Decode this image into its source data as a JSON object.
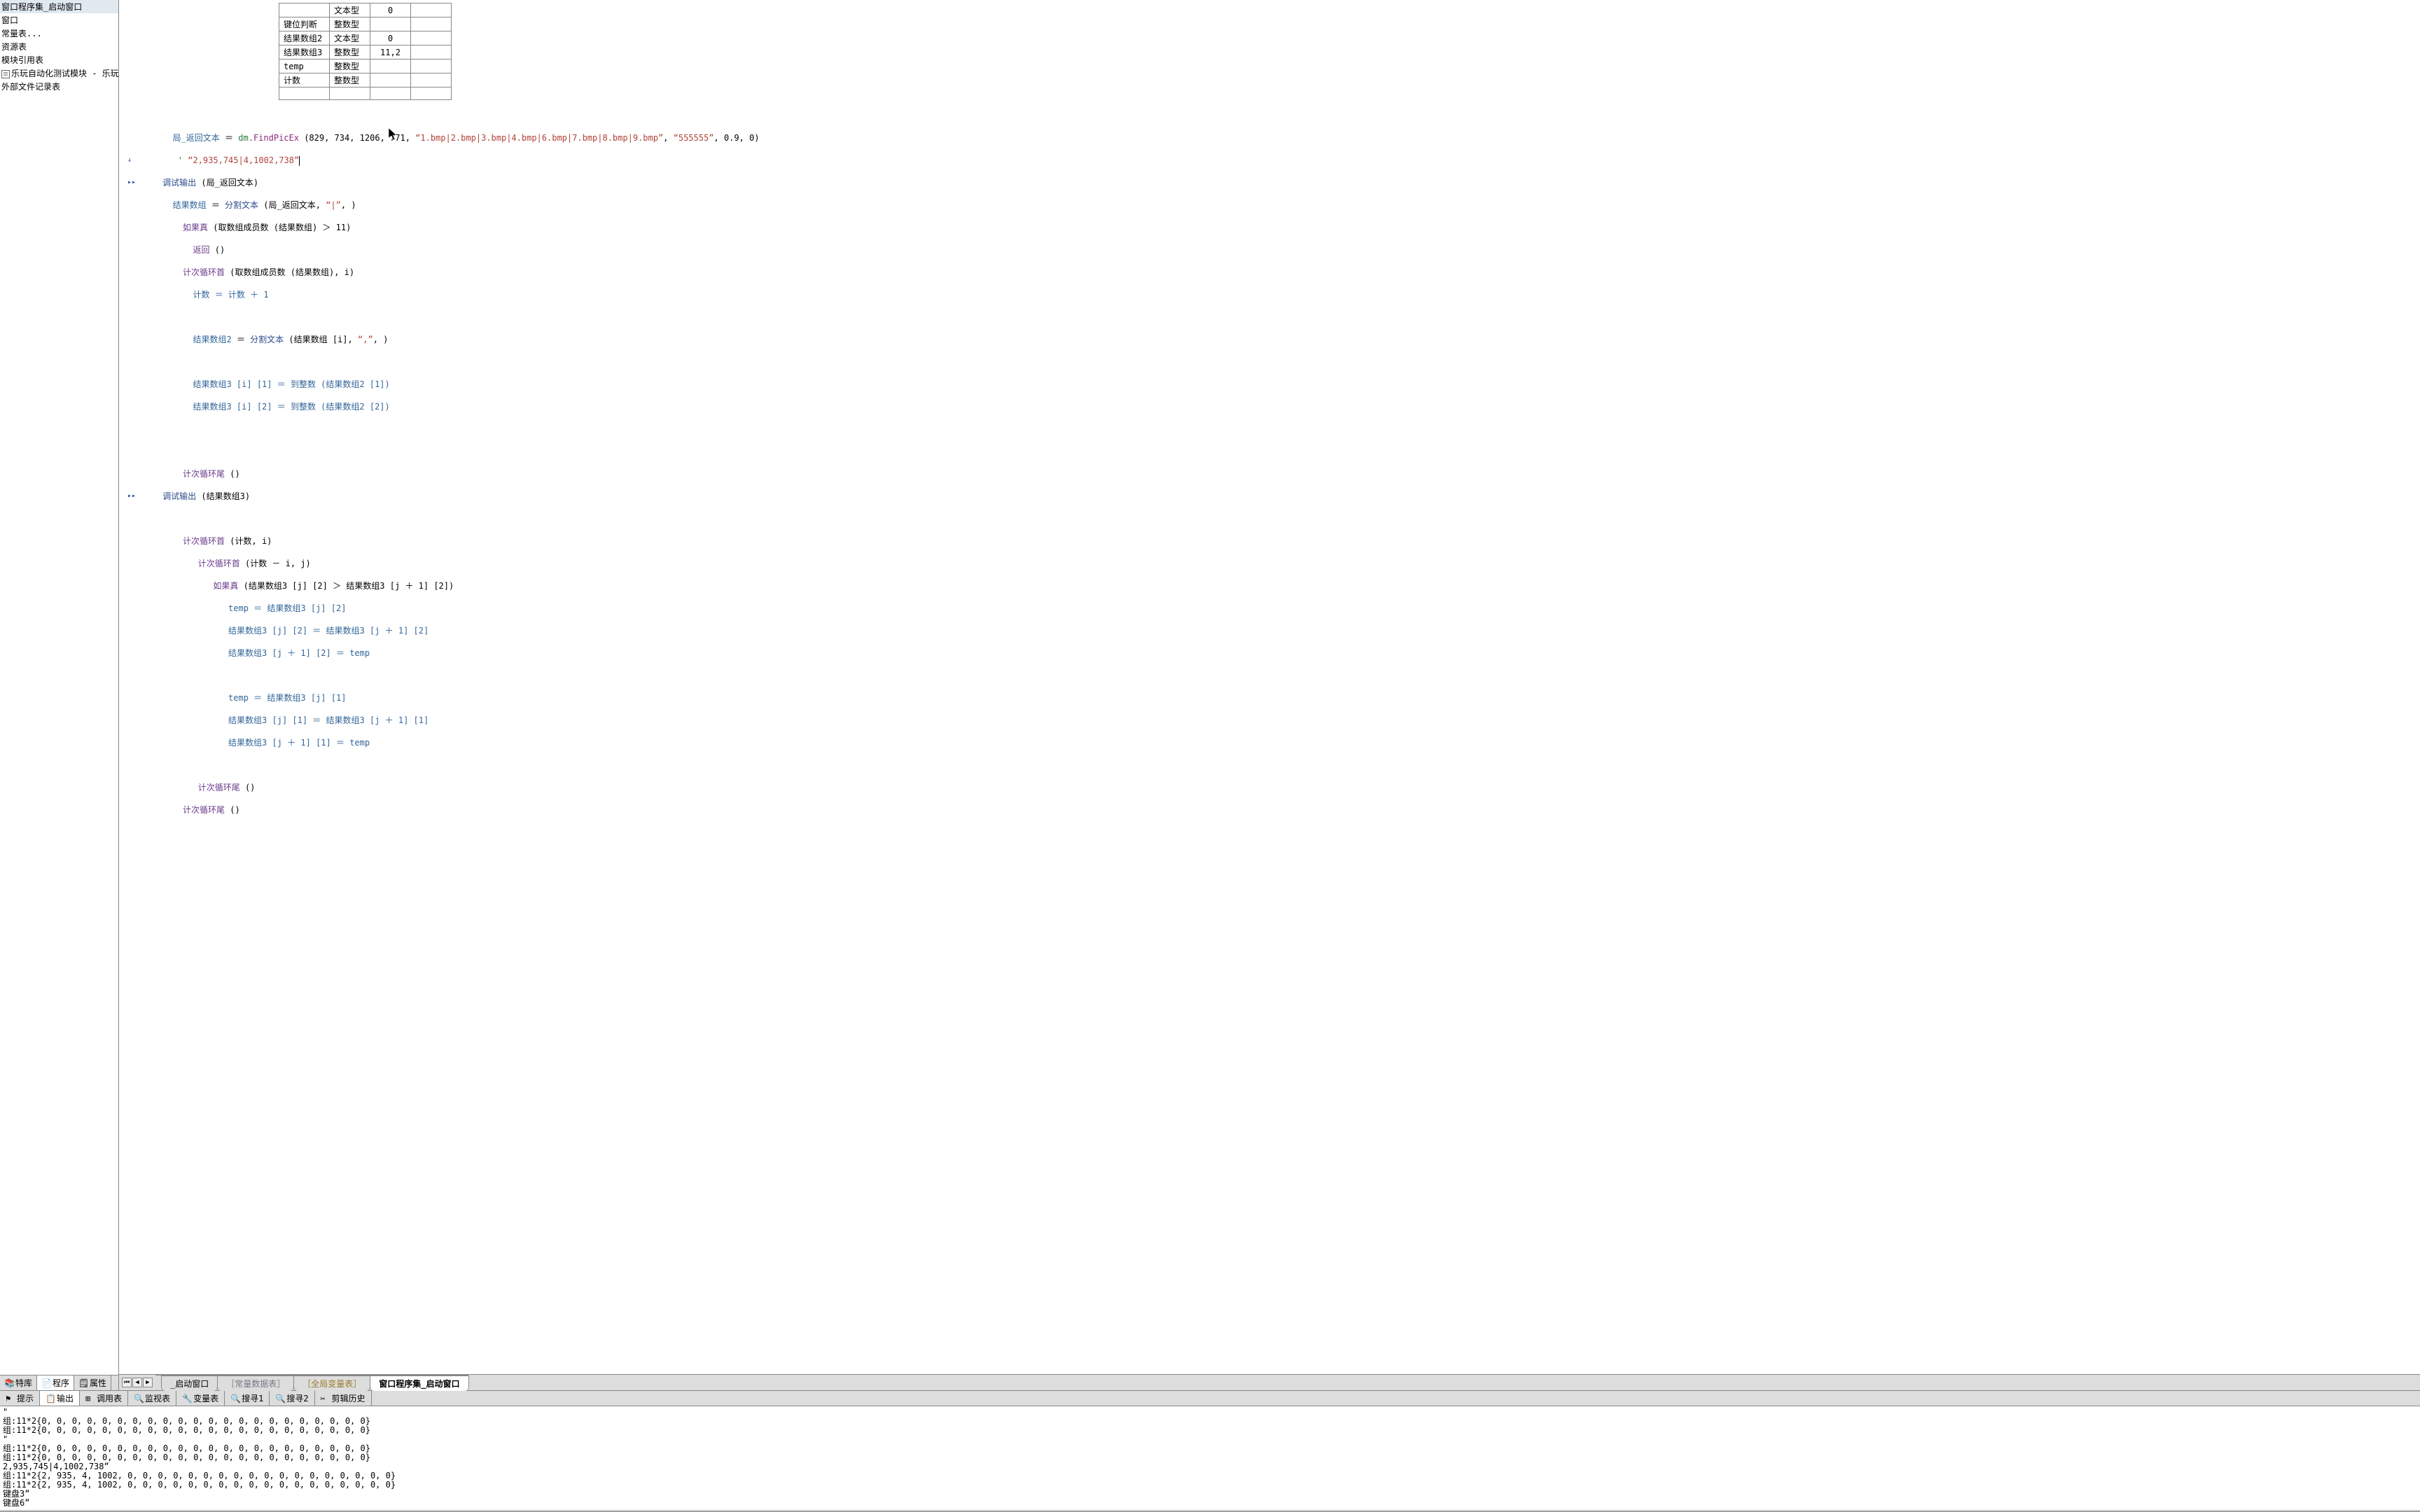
{
  "sidebar": {
    "items": [
      {
        "label": "窗口程序集_启动窗口"
      },
      {
        "label": "窗口"
      },
      {
        "label": "常量表..."
      },
      {
        "label": "资源表"
      },
      {
        "label": "模块引用表"
      },
      {
        "label": "乐玩自动化测试模块 - 乐玩模",
        "icon": true
      },
      {
        "label": "外部文件记录表"
      }
    ],
    "tabs": [
      {
        "label": "特库"
      },
      {
        "label": "程序"
      },
      {
        "label": "属性"
      }
    ]
  },
  "var_table": {
    "rows": [
      {
        "name": "",
        "type": "文本型",
        "val": "0",
        "extra": ""
      },
      {
        "name": "键位判断",
        "type": "整数型",
        "val": "",
        "extra": ""
      },
      {
        "name": "结果数组2",
        "type": "文本型",
        "val": "0",
        "extra": ""
      },
      {
        "name": "结果数组3",
        "type": "整数型",
        "val": "11,2",
        "extra": ""
      },
      {
        "name": "temp",
        "type": "整数型",
        "val": "",
        "extra": ""
      },
      {
        "name": "计数",
        "type": "整数型",
        "val": "",
        "extra": ""
      }
    ]
  },
  "code": {
    "l1_var": "局_返回文本",
    "l1_eq": " ＝ ",
    "l1_obj": "dm.",
    "l1_method": "FindPicEx",
    "l1_args": " (829, 734, 1206, 771, ",
    "l1_str1": "“1.bmp|2.bmp|3.bmp|4.bmp|6.bmp|7.bmp|8.bmp|9.bmp”",
    "l1_mid": ", ",
    "l1_str2": "“555555”",
    "l1_tail": ", 0.9, 0)",
    "l2_comment": "' ",
    "l2_str": "“2,935,745|4,1002,738”",
    "l3_fn": "调试输出",
    "l3_arg": " (局_返回文本)",
    "l4_var": "结果数组",
    "l4_fn": "分割文本",
    "l4_args_a": " (局_返回文本, ",
    "l4_str": "“|”",
    "l4_args_b": ", )",
    "l5_kw": "如果真",
    "l5_args": " (取数组成员数 (结果数组) ＞ 11)",
    "l6_kw": "返回",
    "l6_args": " ()",
    "l7_kw": "计次循环首",
    "l7_args": " (取数组成员数 (结果数组), i)",
    "l8": "计数 ＝ 计数 ＋ 1",
    "l9_var": "结果数组2",
    "l9_fn": "分割文本",
    "l9_args_a": " (结果数组 [i], ",
    "l9_str": "“,”",
    "l9_args_b": ", )",
    "l10": "结果数组3 [i] [1] ＝ 到整数 (结果数组2 [1])",
    "l11": "结果数组3 [i] [2] ＝ 到整数 (结果数组2 [2])",
    "l12_kw": "计次循环尾",
    "l12_args": " ()",
    "l13_fn": "调试输出",
    "l13_arg": " (结果数组3)",
    "l14_kw": "计次循环首",
    "l14_args": " (计数, i)",
    "l15_kw": "计次循环首",
    "l15_args": " (计数 － i, j)",
    "l16_kw": "如果真",
    "l16_args": " (结果数组3 [j] [2] ＞ 结果数组3 [j ＋ 1] [2])",
    "l17": "temp ＝ 结果数组3 [j] [2]",
    "l18": "结果数组3 [j] [2] ＝ 结果数组3 [j ＋ 1] [2]",
    "l19": "结果数组3 [j ＋ 1] [2] ＝ temp",
    "l20": "temp ＝ 结果数组3 [j] [1]",
    "l21": "结果数组3 [j] [1] ＝ 结果数组3 [j ＋ 1] [1]",
    "l22": "结果数组3 [j ＋ 1] [1] ＝ temp",
    "l23_kw": "计次循环尾",
    "l23_args": " ()",
    "l24_kw": "计次循环尾",
    "l24_args": " ()"
  },
  "editor_tabs": [
    {
      "label": "_启动窗口"
    },
    {
      "label": "［常量数据表］",
      "dim": true
    },
    {
      "label": "［全局变量表］",
      "dim": true,
      "gold": true
    },
    {
      "label": "窗口程序集_启动窗口",
      "active": true
    }
  ],
  "bottom_tabs": [
    {
      "label": "提示"
    },
    {
      "label": "输出",
      "active": true
    },
    {
      "label": "调用表"
    },
    {
      "label": "监视表"
    },
    {
      "label": "变量表"
    },
    {
      "label": "搜寻1"
    },
    {
      "label": "搜寻2"
    },
    {
      "label": "剪辑历史"
    }
  ],
  "output": [
    "\"",
    "组:11*2{0, 0, 0, 0, 0, 0, 0, 0, 0, 0, 0, 0, 0, 0, 0, 0, 0, 0, 0, 0, 0, 0}",
    "组:11*2{0, 0, 0, 0, 0, 0, 0, 0, 0, 0, 0, 0, 0, 0, 0, 0, 0, 0, 0, 0, 0, 0}",
    "\"",
    "组:11*2{0, 0, 0, 0, 0, 0, 0, 0, 0, 0, 0, 0, 0, 0, 0, 0, 0, 0, 0, 0, 0, 0}",
    "组:11*2{0, 0, 0, 0, 0, 0, 0, 0, 0, 0, 0, 0, 0, 0, 0, 0, 0, 0, 0, 0, 0, 0}",
    "2,935,745|4,1002,738”",
    "组:11*2{2, 935, 4, 1002, 0, 0, 0, 0, 0, 0, 0, 0, 0, 0, 0, 0, 0, 0, 0, 0, 0, 0}",
    "组:11*2{2, 935, 4, 1002, 0, 0, 0, 0, 0, 0, 0, 0, 0, 0, 0, 0, 0, 0, 0, 0, 0, 0}",
    "键盘3”",
    "键盘6”"
  ]
}
